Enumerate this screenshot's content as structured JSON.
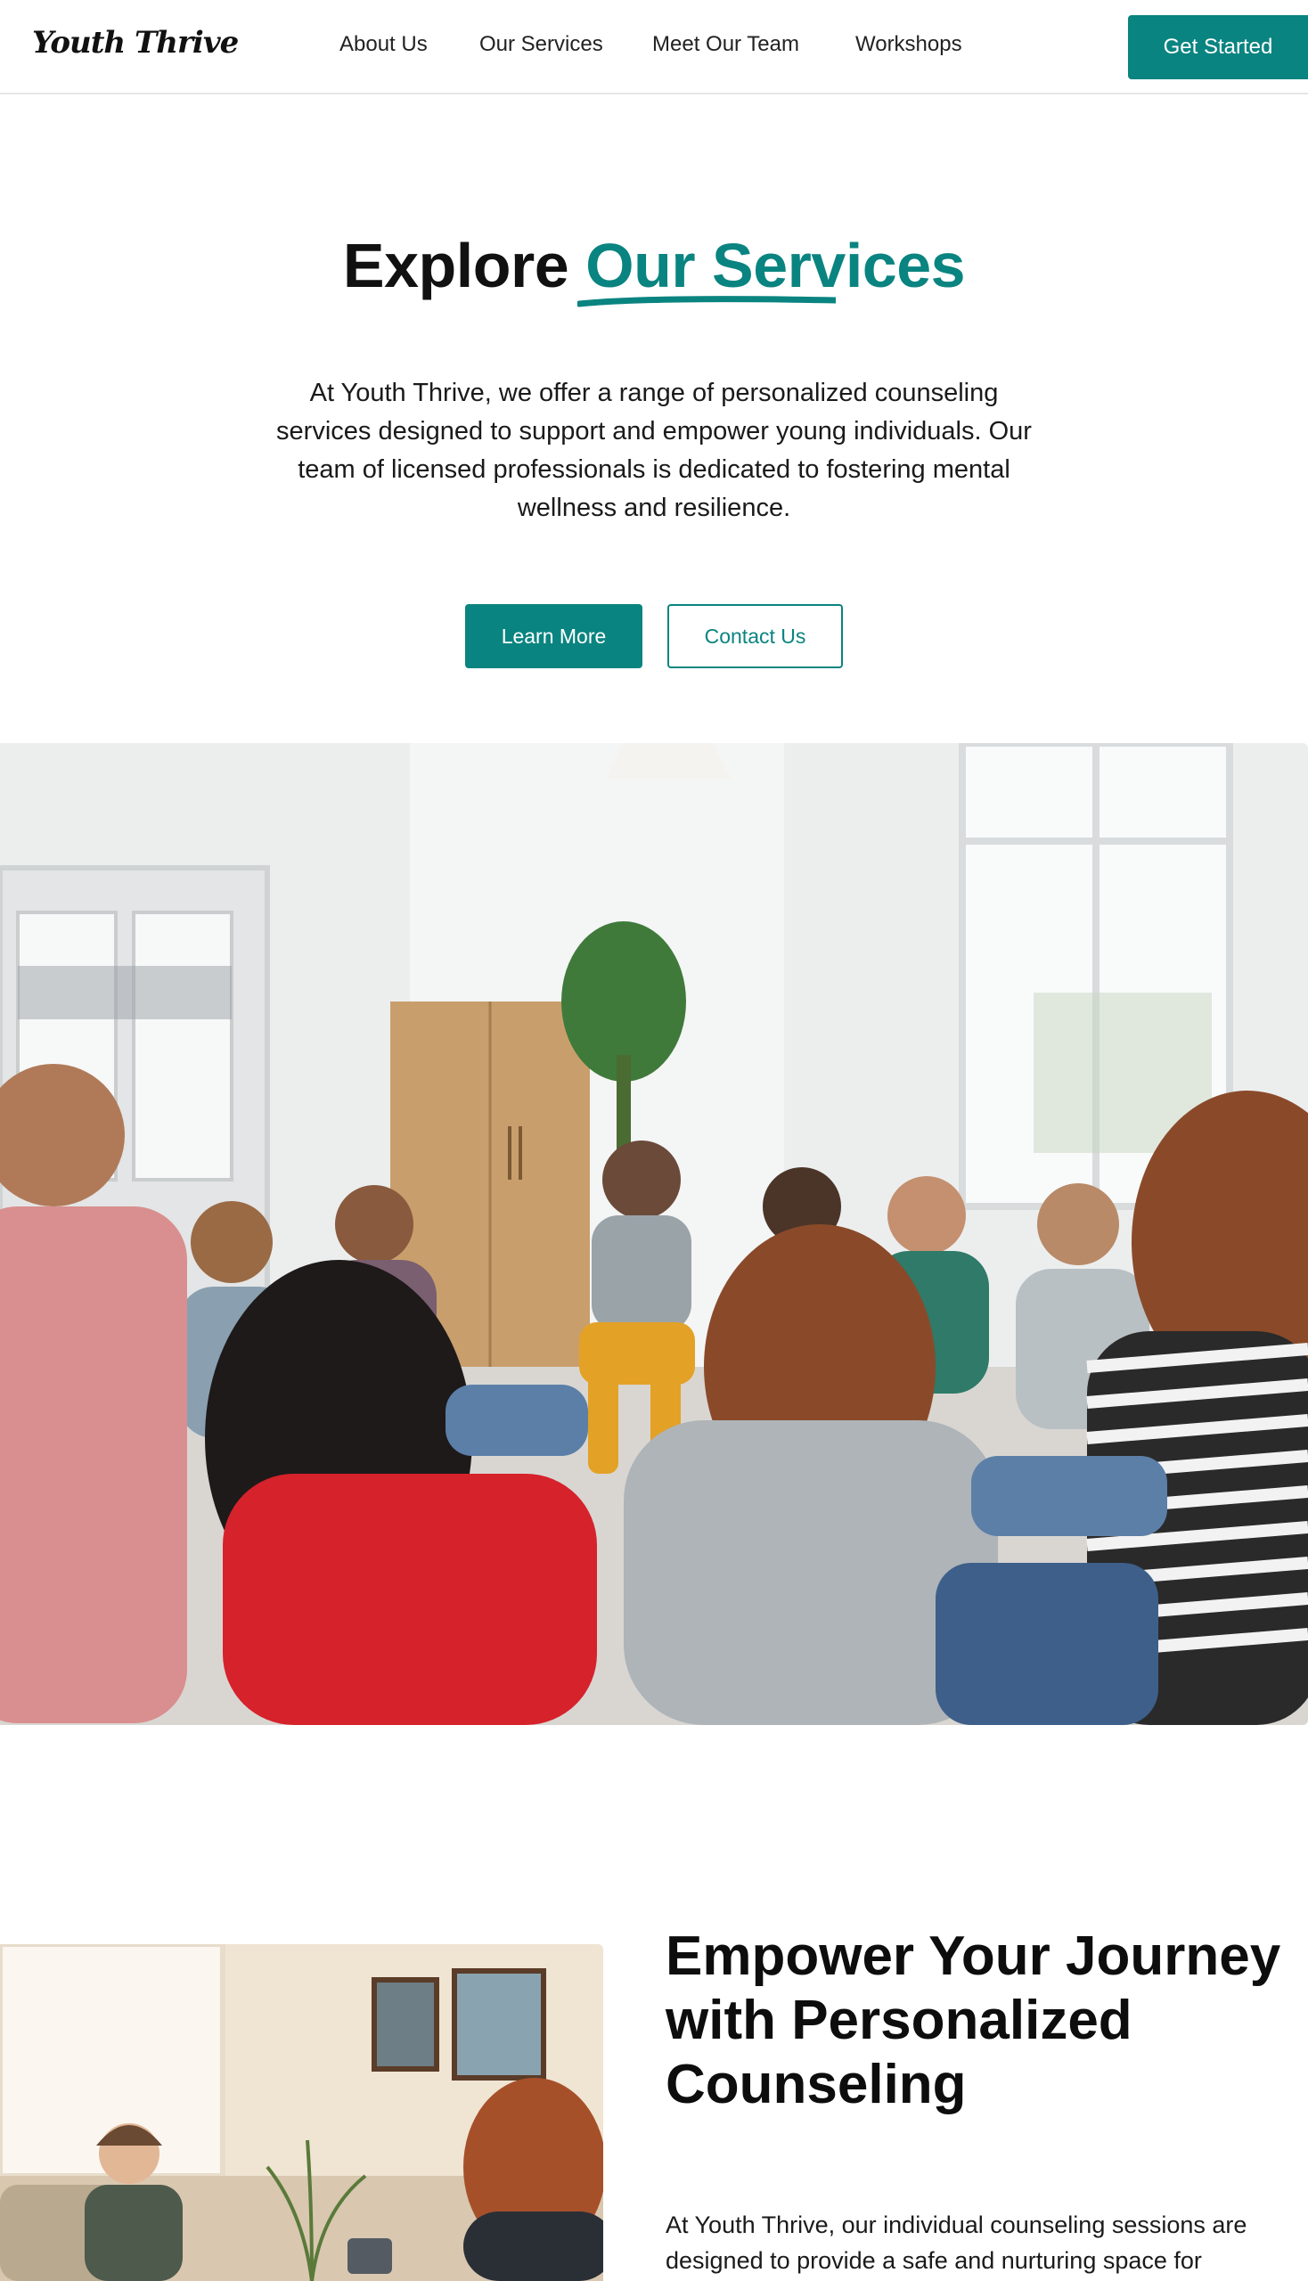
{
  "header": {
    "logo": "Youth Thrive",
    "nav": [
      {
        "label": "About Us"
      },
      {
        "label": "Our Services"
      },
      {
        "label": "Meet Our Team"
      },
      {
        "label": "Workshops"
      }
    ],
    "cta_label": "Get Started"
  },
  "hero": {
    "title_prefix": "Explore",
    "title_accent": "Our Services",
    "description": "At Youth Thrive, we offer a range of personalized counseling services designed to support and empower young individuals. Our team of licensed professionals is dedicated to fostering mental wellness and resilience.",
    "primary_button": "Learn More",
    "secondary_button": "Contact Us"
  },
  "section2": {
    "title": "Empower Your Journey with Personalized Counseling",
    "description": "At Youth Thrive, our individual counseling sessions are designed to provide a safe and nurturing space for"
  },
  "colors": {
    "accent": "#0a8480",
    "text": "#111111",
    "background": "#ffffff"
  }
}
